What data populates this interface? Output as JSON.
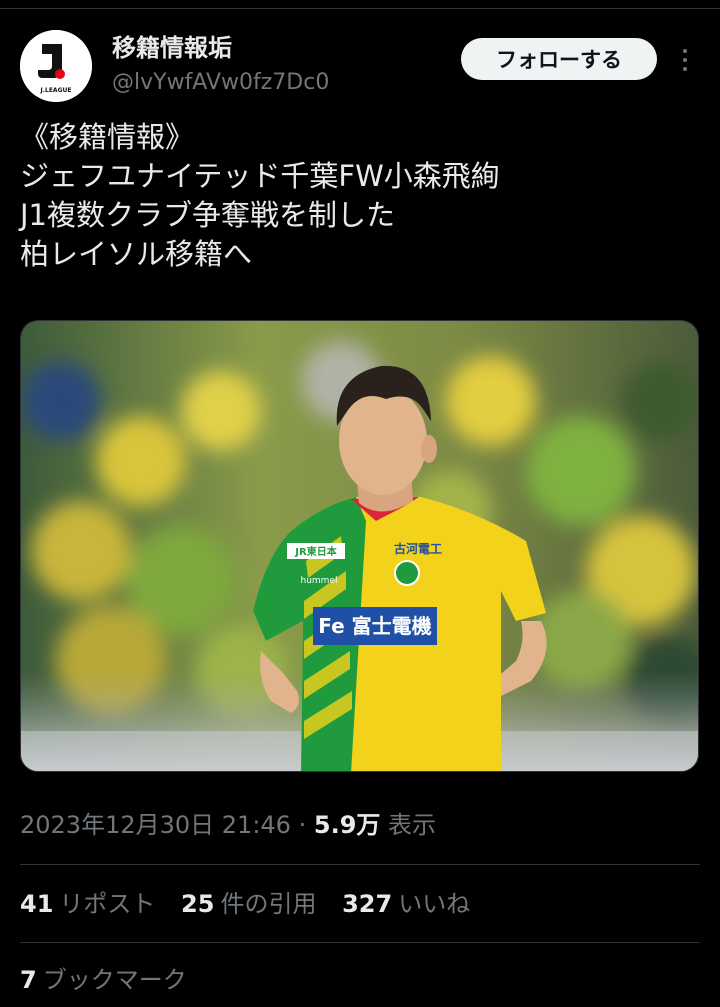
{
  "account": {
    "display_name": "移籍情報垢",
    "handle": "@lvYwfAVw0fz7Dc0",
    "avatar_text": "J.LEAGUE",
    "follow_label": "フォローする"
  },
  "tweet": {
    "lines": [
      "《移籍情報》",
      "ジェフユナイテッド千葉FW小森飛絢",
      "J1複数クラブ争奪戦を制した",
      "柏レイソル移籍へ"
    ],
    "image": {
      "sponsor_chest": "Fe 富士電機",
      "sponsor_left": "JR東日本",
      "sponsor_right": "古河電工",
      "kit_brand": "hummel",
      "colors": {
        "kit_yellow": "#f2d21b",
        "kit_green": "#1f9a3c",
        "sponsor_blue": "#1f4fa6"
      }
    }
  },
  "meta": {
    "timestamp": "2023年12月30日 21:46",
    "separator": "·",
    "views_count": "5.9万",
    "views_label": "表示"
  },
  "stats": {
    "reposts": {
      "count": "41",
      "label": "リポスト"
    },
    "quotes": {
      "count": "25",
      "label": "件の引用"
    },
    "likes": {
      "count": "327",
      "label": "いいね"
    },
    "bookmarks": {
      "count": "7",
      "label": "ブックマーク"
    }
  }
}
